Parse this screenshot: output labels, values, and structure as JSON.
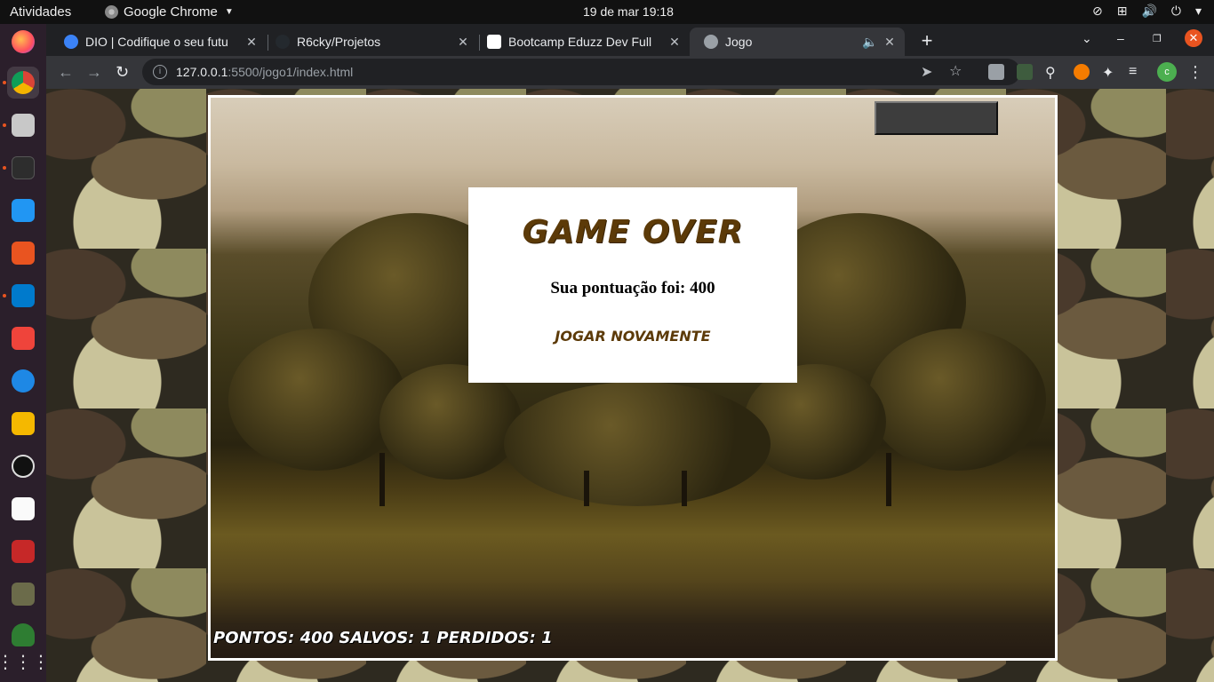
{
  "system": {
    "activities": "Atividades",
    "app_name": "Google Chrome",
    "clock": "19 de mar  19:18"
  },
  "tabs": [
    {
      "title": "DIO | Codifique o seu futu",
      "favicon_color": "#3b82f6"
    },
    {
      "title": "R6cky/Projetos",
      "favicon_color": "#24292e"
    },
    {
      "title": "Bootcamp Eduzz Dev Full",
      "favicon_color": "#ffffff"
    },
    {
      "title": "Jogo",
      "favicon_color": "#9aa0a6"
    }
  ],
  "toolbar": {
    "url_host": "127.0.0.1",
    "url_path": ":5500/jogo1/index.html",
    "profile_initial": "c"
  },
  "game": {
    "modal_title": "GAME OVER",
    "score_text": "Sua pontuação foi: 400",
    "replay_label": "JOGAR NOVAMENTE",
    "hud_text": "PONTOS: 400 SALVOS: 1 PERDIDOS: 1"
  },
  "colors": {
    "accent_brown": "#5c3a08",
    "ubuntu_orange": "#e95420"
  }
}
